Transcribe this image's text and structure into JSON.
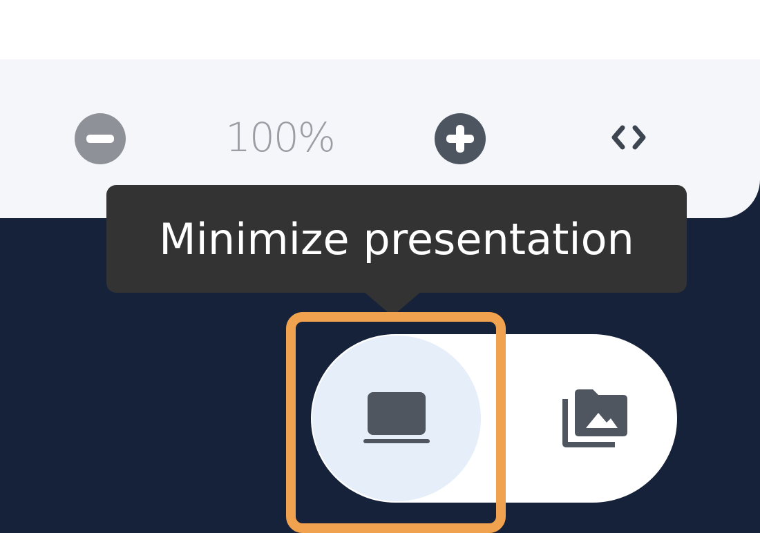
{
  "toolbar": {
    "zoom_level": "100%",
    "zoom_out_icon": "minus-circle-icon",
    "zoom_in_icon": "plus-circle-icon",
    "code_toggle_icon": "code-brackets-icon"
  },
  "tooltip": {
    "text": "Minimize presentation"
  },
  "layout_switch": {
    "presentation_icon": "laptop-icon",
    "media_icon": "photo-library-icon"
  },
  "colors": {
    "background": "#16223a",
    "toolbar": "#f4f6f9",
    "tooltip": "#333333",
    "highlight": "#f0a24e",
    "active_button": "#e6eef9",
    "icon": "#4d5560"
  }
}
